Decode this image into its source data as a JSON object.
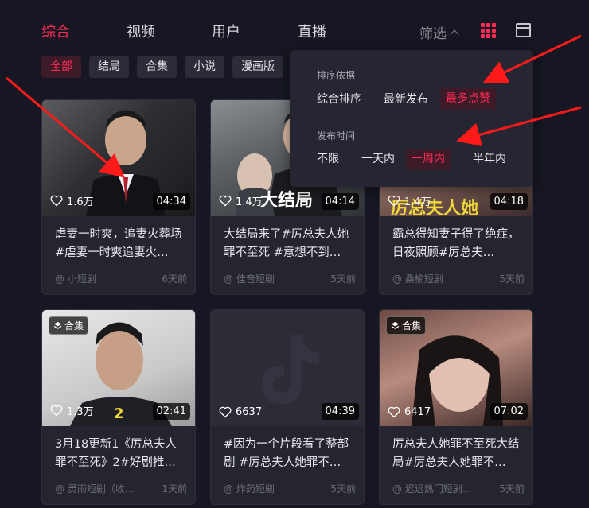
{
  "tabs": [
    {
      "label": "综合",
      "active": true
    },
    {
      "label": "视频",
      "active": false
    },
    {
      "label": "用户",
      "active": false
    },
    {
      "label": "直播",
      "active": false
    }
  ],
  "filter_toggle": {
    "label": "筛选"
  },
  "chips": [
    {
      "label": "全部",
      "active": true
    },
    {
      "label": "结局"
    },
    {
      "label": "合集"
    },
    {
      "label": "小说"
    },
    {
      "label": "漫画版"
    }
  ],
  "filter_panel": {
    "sort_label": "排序依据",
    "sort_options": [
      {
        "label": "综合排序",
        "active": false
      },
      {
        "label": "最新发布",
        "active": false
      },
      {
        "label": "最多点赞",
        "active": true
      }
    ],
    "time_label": "发布时间",
    "time_options": [
      {
        "label": "不限",
        "active": false
      },
      {
        "label": "一天内",
        "active": false
      },
      {
        "label": "一周内",
        "active": true
      },
      {
        "label": "半年内",
        "active": false
      }
    ]
  },
  "cards": [
    {
      "likes": "1.6万",
      "duration": "04:34",
      "title": "虐妻一时爽，追妻火葬场#虐妻一时爽追妻火…",
      "author": "@ 小短剧",
      "time": "6天前",
      "badge": ""
    },
    {
      "likes": "1.4万",
      "duration": "04:14",
      "title": "大结局来了#厉总夫人她罪不至死 #意想不到…",
      "author": "@ 佳音短剧",
      "time": "5天前",
      "badge": "",
      "overlay": "大结局"
    },
    {
      "likes": "1.4万",
      "duration": "04:18",
      "title": "霸总得知妻子得了绝症，日夜照顾#厉总夫…",
      "author": "@ 桑榆短剧",
      "time": "5天前",
      "badge": "",
      "overlay": "厉总夫人她"
    },
    {
      "likes": "1.3万",
      "duration": "02:41",
      "title": "3月18更新1《厉总夫人罪不至死》2#好剧推…",
      "author": "@ 灵雨短剧（收…",
      "time": "1天前",
      "badge": "合集",
      "overlay": "2"
    },
    {
      "likes": "6637",
      "duration": "04:39",
      "title": "#因为一个片段看了整部剧 #厉总夫人她罪不…",
      "author": "@ 炸药短剧",
      "time": "5天前",
      "badge": ""
    },
    {
      "likes": "6417",
      "duration": "07:02",
      "title": "厉总夫人她罪不至死大结局#厉总夫人她罪不…",
      "author": "@ 迟迟热门短剧…",
      "time": "5天前",
      "badge": "合集"
    }
  ],
  "colors": {
    "accent": "#fe2c55",
    "background": "#161722",
    "card": "#24252f"
  }
}
